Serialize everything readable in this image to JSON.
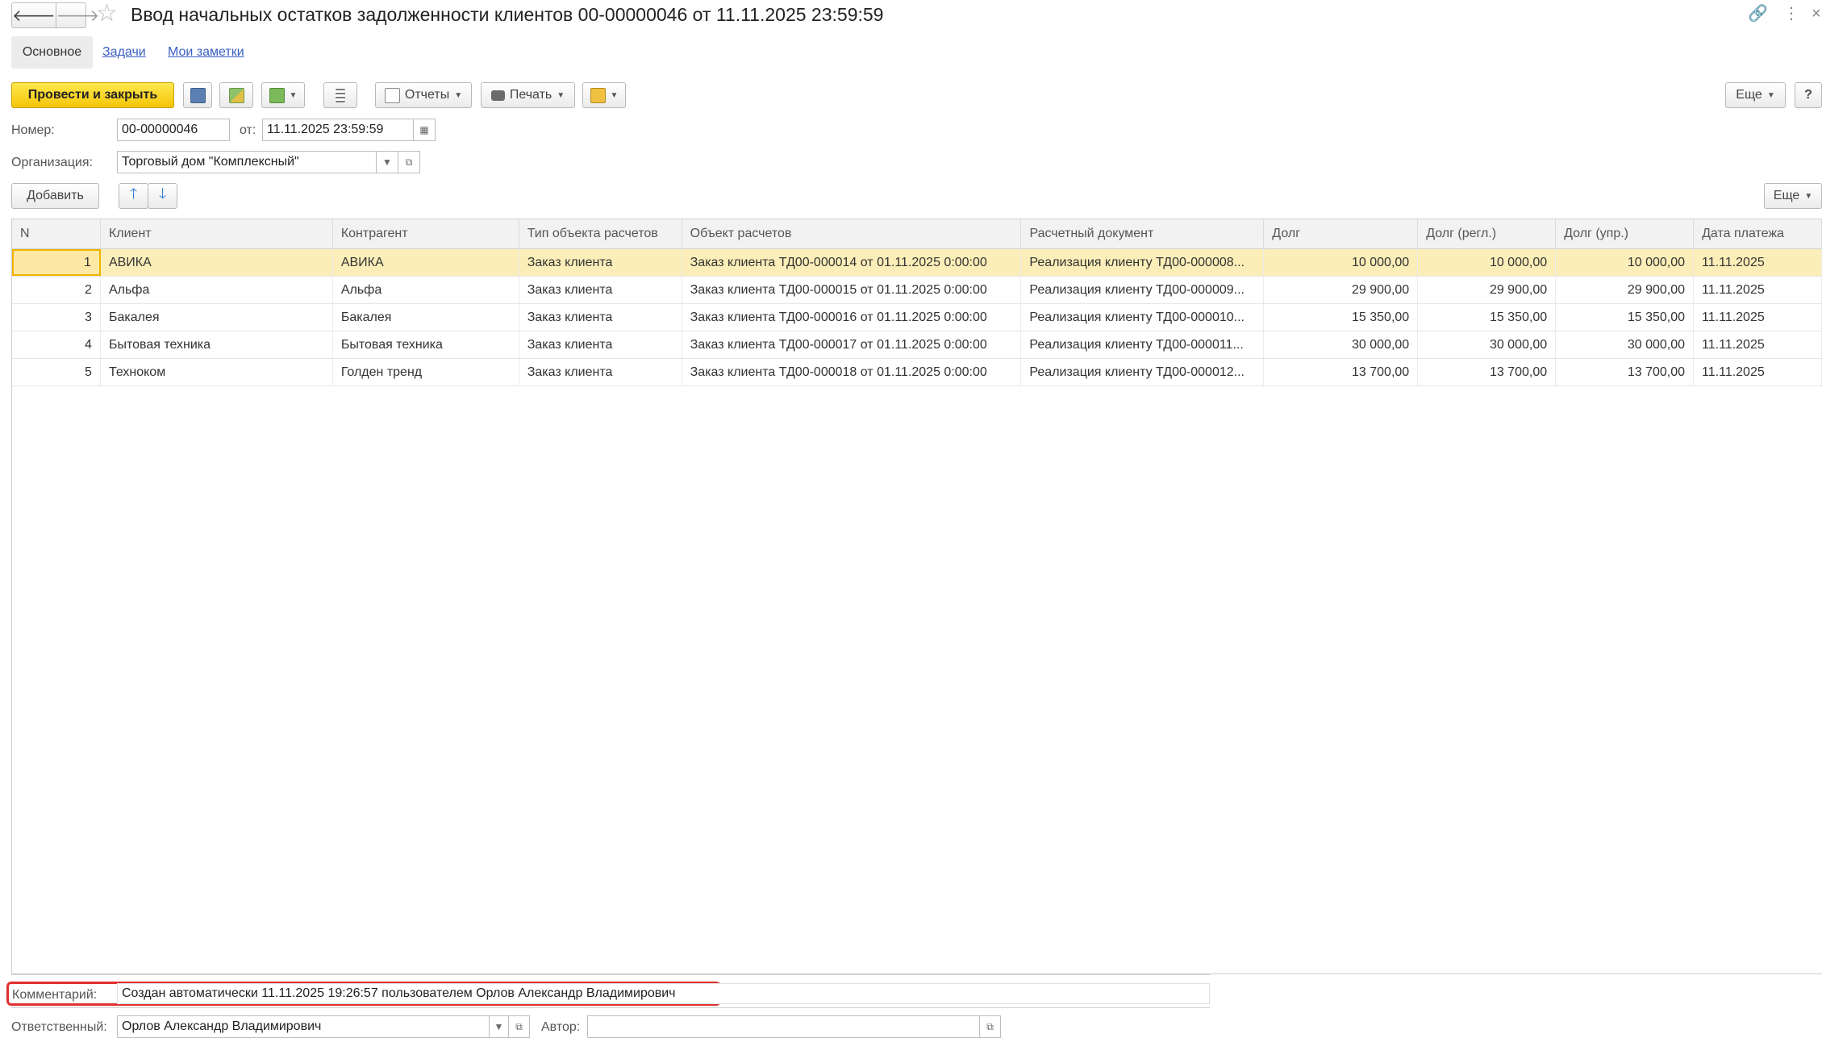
{
  "window": {
    "title": "Ввод начальных остатков задолженности клиентов 00-00000046 от 11.11.2025 23:59:59",
    "back_icon": "arrow-left-icon",
    "forward_icon": "arrow-right-icon",
    "favorite_icon": "star-icon",
    "link_icon": "link-icon",
    "menu_icon": "kebab-menu-icon",
    "close_icon": "close-icon"
  },
  "tabs": [
    {
      "label": "Основное",
      "active": true
    },
    {
      "label": "Задачи",
      "active": false
    },
    {
      "label": "Мои заметки",
      "active": false
    }
  ],
  "toolbar": {
    "post_close": "Провести и закрыть",
    "reports": "Отчеты",
    "print": "Печать",
    "more": "Еще",
    "help": "?"
  },
  "form": {
    "number_label": "Номер:",
    "number_value": "00-00000046",
    "date_label": "от:",
    "date_value": "11.11.2025 23:59:59",
    "org_label": "Организация:",
    "org_value": "Торговый дом \"Комплексный\""
  },
  "table_toolbar": {
    "add": "Добавить",
    "more": "Еще"
  },
  "table": {
    "headers": [
      "N",
      "Клиент",
      "Контрагент",
      "Тип объекта расчетов",
      "Объект расчетов",
      "Расчетный документ",
      "Долг",
      "Долг (регл.)",
      "Долг (упр.)",
      "Дата платежа"
    ],
    "rows": [
      [
        "1",
        "АВИКА",
        "АВИКА",
        "Заказ клиента",
        "Заказ клиента ТД00-000014 от 01.11.2025 0:00:00",
        "Реализация клиенту ТД00-000008...",
        "10 000,00",
        "10 000,00",
        "10 000,00",
        "11.11.2025"
      ],
      [
        "2",
        "Альфа",
        "Альфа",
        "Заказ клиента",
        "Заказ клиента ТД00-000015 от 01.11.2025 0:00:00",
        "Реализация клиенту ТД00-000009...",
        "29 900,00",
        "29 900,00",
        "29 900,00",
        "11.11.2025"
      ],
      [
        "3",
        "Бакалея",
        "Бакалея",
        "Заказ клиента",
        "Заказ клиента ТД00-000016 от 01.11.2025 0:00:00",
        "Реализация клиенту ТД00-000010...",
        "15 350,00",
        "15 350,00",
        "15 350,00",
        "11.11.2025"
      ],
      [
        "4",
        "Бытовая техника",
        "Бытовая техника",
        "Заказ клиента",
        "Заказ клиента ТД00-000017 от 01.11.2025 0:00:00",
        "Реализация клиенту ТД00-000011...",
        "30 000,00",
        "30 000,00",
        "30 000,00",
        "11.11.2025"
      ],
      [
        "5",
        "Техноком",
        "Голден тренд",
        "Заказ клиента",
        "Заказ клиента ТД00-000018 от 01.11.2025 0:00:00",
        "Реализация клиенту ТД00-000012...",
        "13 700,00",
        "13 700,00",
        "13 700,00",
        "11.11.2025"
      ]
    ]
  },
  "footer": {
    "comment_label": "Комментарий:",
    "comment_value": "Создан автоматически 11.11.2025 19:26:57 пользователем Орлов Александр Владимирович",
    "responsible_label": "Ответственный:",
    "responsible_value": "Орлов Александр Владимирович",
    "author_label": "Автор:",
    "author_value": ""
  },
  "colors": {
    "primary_button": "#f4c50a",
    "selected_row": "#fbeeb8",
    "link": "#3a5ec1",
    "highlight_frame": "#e03030"
  }
}
